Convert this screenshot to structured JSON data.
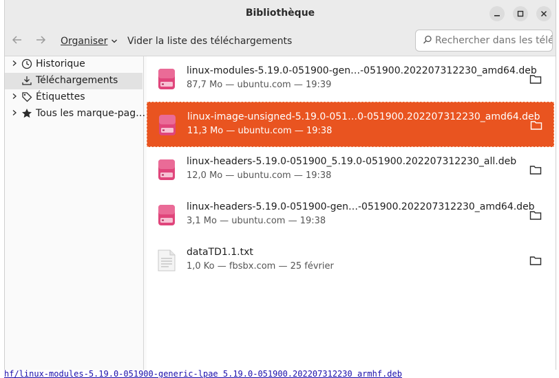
{
  "window": {
    "title": "Bibliothèque"
  },
  "toolbar": {
    "organize_label": "Organiser",
    "clear_label": "Vider la liste des téléchargements",
    "search_placeholder": "Rechercher dans les téléchargements"
  },
  "sidebar": {
    "items": [
      {
        "label": "Historique",
        "icon": "clock-icon"
      },
      {
        "label": "Téléchargements",
        "icon": "download-icon",
        "selected": true
      },
      {
        "label": "Étiquettes",
        "icon": "tag-icon"
      },
      {
        "label": "Tous les marque-pag…",
        "icon": "star-icon"
      }
    ]
  },
  "downloads": [
    {
      "name": "linux-modules-5.19.0-051900-gen…-051900.202207312230_amd64.deb",
      "meta": "87,7 Mo — ubuntu.com — 19:39",
      "type": "deb"
    },
    {
      "name": "linux-image-unsigned-5.19.0-051…0-051900.202207312230_amd64.deb",
      "meta": "11,3 Mo — ubuntu.com — 19:38",
      "type": "deb",
      "selected": true
    },
    {
      "name": "linux-headers-5.19.0-051900_5.19.0-051900.202207312230_all.deb",
      "meta": "12,0 Mo — ubuntu.com — 19:38",
      "type": "deb"
    },
    {
      "name": "linux-headers-5.19.0-051900-gen…-051900.202207312230_amd64.deb",
      "meta": "3,1 Mo — ubuntu.com — 19:38",
      "type": "deb"
    },
    {
      "name": "dataTD1.1.txt",
      "meta": "1,0 Ko — fbsbx.com — 25 février",
      "type": "txt"
    }
  ],
  "background": {
    "bottom_link": "hf/linux-modules-5.19.0-051900-generic-lpae_5.19.0-051900.202207312230_armhf.deb"
  },
  "colors": {
    "accent": "#e95420",
    "deb_icon": "#e0457b"
  }
}
